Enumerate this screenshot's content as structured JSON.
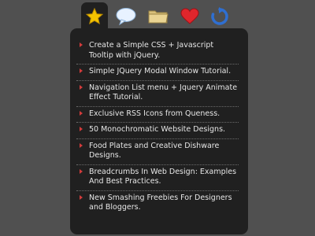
{
  "tabs": [
    {
      "icon": "star-icon",
      "active": true
    },
    {
      "icon": "speech-bubble-icon",
      "active": false
    },
    {
      "icon": "folder-icon",
      "active": false
    },
    {
      "icon": "heart-icon",
      "active": false
    },
    {
      "icon": "refresh-icon",
      "active": false
    }
  ],
  "colors": {
    "background": "#505050",
    "panel": "#202020",
    "text": "#e6e6e6",
    "bullet": "#d23b3b",
    "star": "#f5c400",
    "heart": "#e0262c",
    "refresh": "#2f6fd1"
  },
  "list": {
    "items": [
      {
        "label": "Create a Simple CSS + Javascript Tooltip with jQuery."
      },
      {
        "label": "Simple JQuery Modal Window Tutorial."
      },
      {
        "label": "Navigation List menu + Jquery Animate Effect Tutorial."
      },
      {
        "label": "Exclusive RSS Icons from Queness."
      },
      {
        "label": "50 Monochromatic Website Designs."
      },
      {
        "label": "Food Plates and Creative Dishware Designs."
      },
      {
        "label": "Breadcrumbs In Web Design: Examples And Best Practices."
      },
      {
        "label": "New Smashing Freebies For Designers and Bloggers."
      }
    ]
  }
}
